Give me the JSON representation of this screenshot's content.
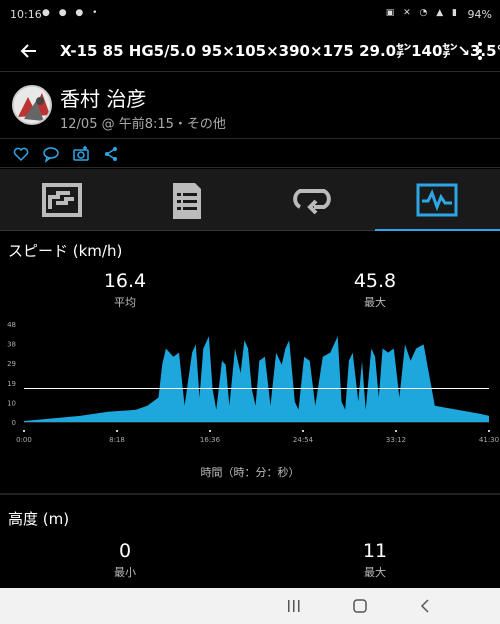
{
  "status_bar": {
    "time": "10:16",
    "battery": "94%"
  },
  "app_bar": {
    "title": "X-15 85 HG5/5.0 95×105×390×175 29.0㌢140㌢↘3.5℃"
  },
  "user": {
    "name": "香村 治彦",
    "meta": "12/05 @ 午前8:15・その他"
  },
  "speed": {
    "title": "スピード (km/h)",
    "avg_value": "16.4",
    "avg_label": "平均",
    "max_value": "45.8",
    "max_label": "最大",
    "x_axis_title": "時間（時：分：秒）"
  },
  "altitude": {
    "title": "高度 (m)",
    "min_value": "0",
    "min_label": "最小",
    "max_value": "11",
    "max_label": "最大"
  },
  "colors": {
    "accent": "#2ea6e5",
    "area_fill": "#1ea7dc",
    "avg_line": "#ffffff"
  },
  "chart_data": {
    "type": "area",
    "title": "",
    "xlabel": "時間（時：分：秒）",
    "ylabel": "",
    "x_tick_labels": [
      "0:00",
      "8:18",
      "16:36",
      "24:54",
      "33:12",
      "41:30"
    ],
    "y_tick_labels": [
      "0",
      "10",
      "19",
      "29",
      "38",
      "48"
    ],
    "x_range_seconds": [
      0,
      2490
    ],
    "ylim": [
      0,
      48
    ],
    "average": 16.4,
    "series": [
      {
        "x": [
          0,
          300,
          450,
          600,
          660,
          720,
          740,
          760,
          800,
          830,
          860,
          900,
          920,
          940,
          960,
          990,
          1010,
          1030,
          1060,
          1080,
          1100,
          1130,
          1160,
          1180,
          1200,
          1220,
          1240,
          1260,
          1290,
          1320,
          1350,
          1380,
          1400,
          1420,
          1450,
          1470,
          1500,
          1530,
          1560,
          1600,
          1640,
          1660,
          1680,
          1700,
          1720,
          1740,
          1760,
          1790,
          1810,
          1830,
          1860,
          1880,
          1900,
          1920,
          1950,
          1980,
          2010,
          2040,
          2070,
          2100,
          2140,
          2200,
          2260,
          2320,
          2380,
          2440,
          2490
        ],
        "y": [
          0.5,
          3,
          5,
          6,
          8,
          12,
          28,
          36,
          32,
          34,
          8,
          34,
          38,
          12,
          36,
          42,
          16,
          6,
          30,
          28,
          8,
          36,
          24,
          40,
          36,
          16,
          8,
          30,
          32,
          8,
          34,
          28,
          36,
          40,
          10,
          6,
          32,
          30,
          8,
          32,
          34,
          38,
          42,
          10,
          6,
          30,
          34,
          10,
          30,
          6,
          36,
          32,
          12,
          36,
          34,
          36,
          12,
          38,
          30,
          36,
          38,
          8,
          7,
          6,
          5,
          4,
          3
        ]
      }
    ]
  }
}
